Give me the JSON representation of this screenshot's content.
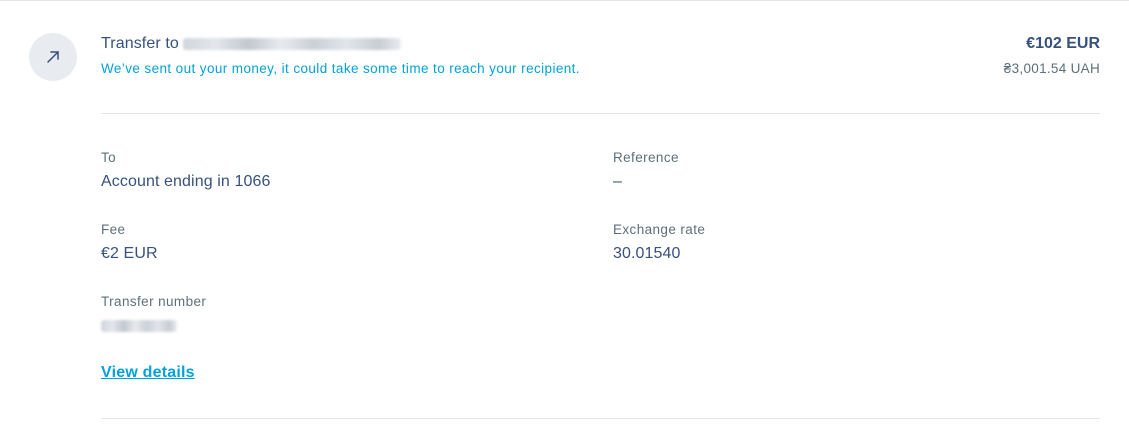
{
  "transfer": {
    "icon": "arrow-up-right-icon",
    "title_prefix": "Transfer to",
    "status": "We’ve sent out your money, it could take some time to reach your recipient.",
    "amount_sent": "€102 EUR",
    "amount_received": "₴3,001.54 UAH"
  },
  "details": {
    "to": {
      "label": "To",
      "value": "Account ending in 1066"
    },
    "reference": {
      "label": "Reference",
      "value": "–"
    },
    "fee": {
      "label": "Fee",
      "value": "€2 EUR"
    },
    "exchange_rate": {
      "label": "Exchange rate",
      "value": "30.01540"
    },
    "transfer_number": {
      "label": "Transfer number"
    }
  },
  "actions": {
    "view_details": "View details"
  },
  "colors": {
    "text_primary": "#37517e",
    "text_secondary": "#5d7079",
    "accent": "#00a2dd",
    "icon_bg": "#e8ebef",
    "divider": "#e2e6e8"
  }
}
